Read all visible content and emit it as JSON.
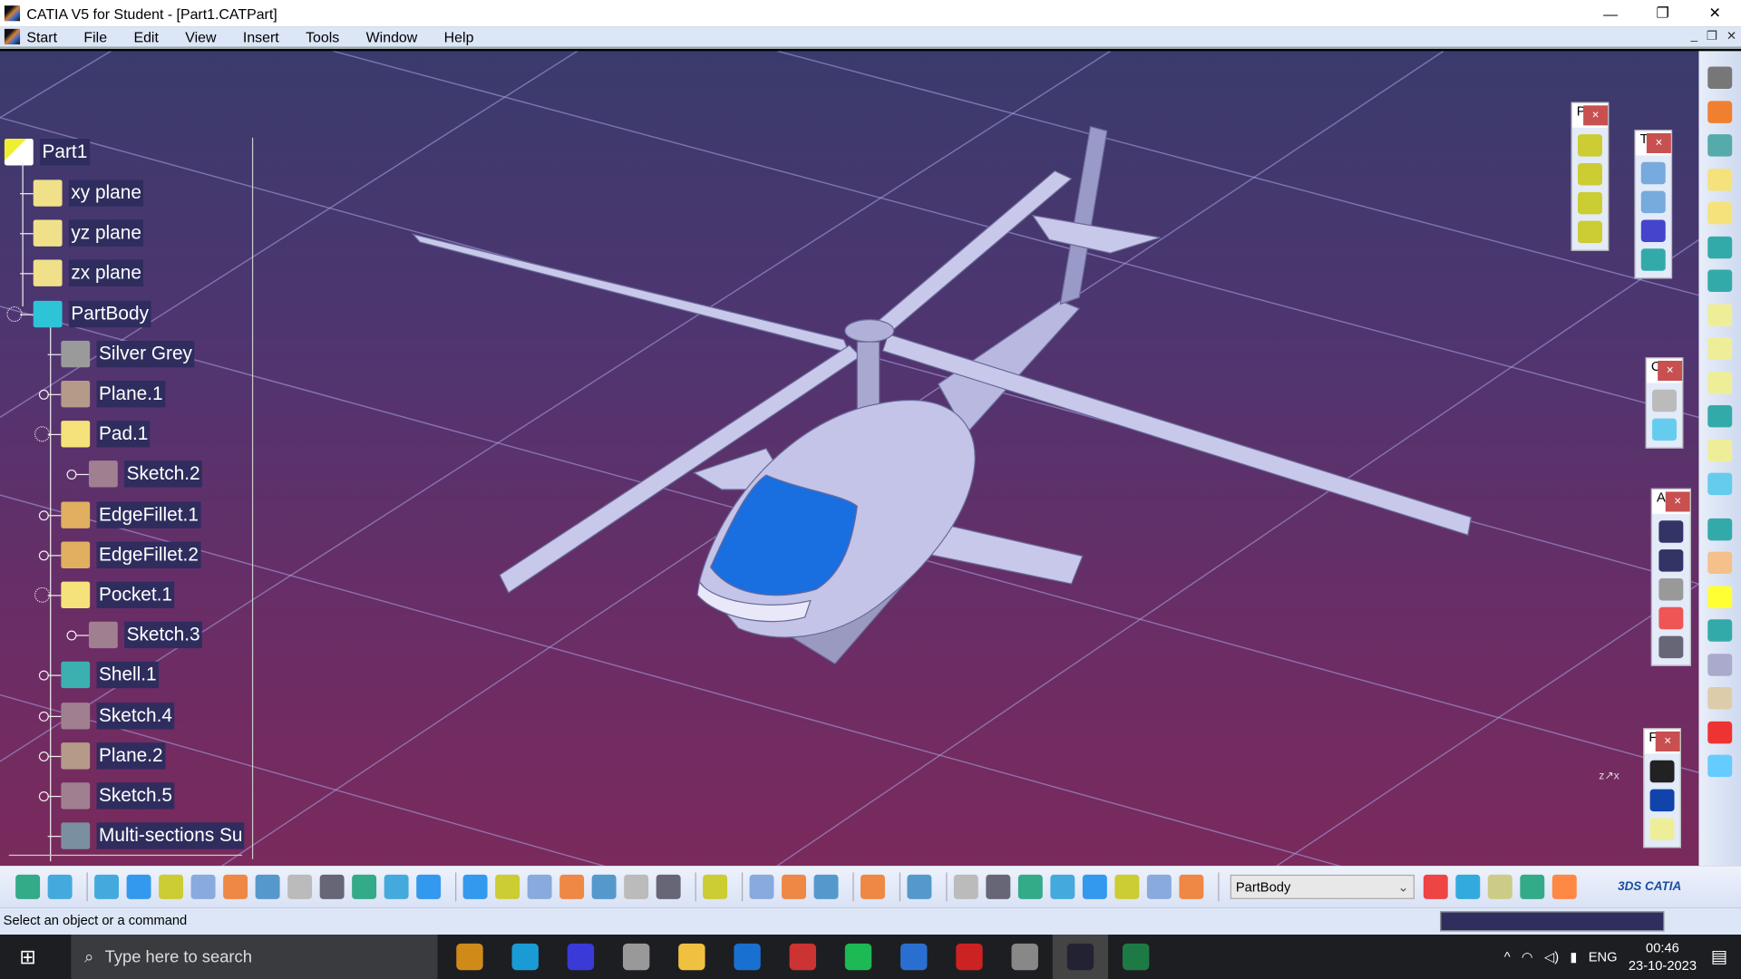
{
  "window": {
    "title": "CATIA V5 for Student - [Part1.CATPart]",
    "minimize": "—",
    "restore": "❐",
    "close": "✕"
  },
  "menu": [
    "Start",
    "File",
    "Edit",
    "View",
    "Insert",
    "Tools",
    "Window",
    "Help"
  ],
  "mdi_controls": [
    "_",
    "❐",
    "✕"
  ],
  "tree": {
    "root": "Part1",
    "items": [
      {
        "label": "xy plane",
        "icon": "plane-icon",
        "color": "#f0e08a"
      },
      {
        "label": "yz plane",
        "icon": "plane-icon",
        "color": "#f0e08a"
      },
      {
        "label": "zx plane",
        "icon": "plane-icon",
        "color": "#f0e08a"
      },
      {
        "label": "PartBody",
        "icon": "body-gear-icon",
        "color": "#2ec4d8"
      },
      {
        "label": "Silver Grey",
        "icon": "material-sphere-icon",
        "color": "#9a9a9a"
      },
      {
        "label": "Plane.1",
        "icon": "plane-feature-icon",
        "color": "#b59a8a"
      },
      {
        "label": "Pad.1",
        "icon": "pad-icon",
        "color": "#f5e27a"
      },
      {
        "label": "Sketch.2",
        "icon": "sketch-icon",
        "color": "#a08090"
      },
      {
        "label": "EdgeFillet.1",
        "icon": "edge-fillet-icon",
        "color": "#e0b060"
      },
      {
        "label": "EdgeFillet.2",
        "icon": "edge-fillet-icon",
        "color": "#e0b060"
      },
      {
        "label": "Pocket.1",
        "icon": "pocket-icon",
        "color": "#f5e27a"
      },
      {
        "label": "Sketch.3",
        "icon": "sketch-icon",
        "color": "#a08090"
      },
      {
        "label": "Shell.1",
        "icon": "shell-icon",
        "color": "#3ab0b0"
      },
      {
        "label": "Sketch.4",
        "icon": "sketch-icon",
        "color": "#a08090"
      },
      {
        "label": "Plane.2",
        "icon": "plane-feature-icon",
        "color": "#b59a8a"
      },
      {
        "label": "Sketch.5",
        "icon": "sketch-icon",
        "color": "#a08090"
      },
      {
        "label": "Multi-sections Su",
        "icon": "multi-sections-surface-icon",
        "color": "#7a90a0"
      }
    ]
  },
  "palettes": [
    {
      "title": "P",
      "icons": [
        "power-copy-icon",
        "power-copy-red-icon",
        "power-copy-blue-icon",
        "power-copy-instantiate-icon"
      ]
    },
    {
      "title": "T",
      "icons": [
        "translate-icon",
        "mirror-icon",
        "pattern-icon",
        "scaling-icon"
      ]
    },
    {
      "title": "C",
      "icons": [
        "constraint-dialog-icon",
        "constraint-icon"
      ]
    },
    {
      "title": "A",
      "icons": [
        "text-leader-icon",
        "flag-note-icon",
        "annotation-plane-icon",
        "3d-annotation-icon",
        "annotation-query-icon"
      ]
    },
    {
      "title": "F",
      "icons": [
        "point-icon",
        "line-icon",
        "plane-icon"
      ]
    }
  ],
  "right_toolbar": [
    "settings-icon",
    "select-icon",
    "sketch-icon",
    "pad-icon",
    "pocket-icon",
    "shaft-icon",
    "groove-icon",
    "hole-icon",
    "rib-icon",
    "slot-icon",
    "stiffener-icon",
    "multi-section-solid-icon",
    "removed-multi-section-icon",
    "edge-fillet-icon",
    "chamfer-icon",
    "draft-icon",
    "shell-icon",
    "thickness-icon",
    "thread-icon",
    "remove-face-icon",
    "surface-split-icon"
  ],
  "toolbar": {
    "groups": [
      [
        "undo-icon",
        "redo-icon"
      ],
      [
        "fly-mode-icon",
        "fit-all-icon",
        "pan-icon",
        "rotate-icon",
        "zoom-in-icon",
        "zoom-out-icon",
        "normal-view-icon",
        "iso-view-icon",
        "shading-icon",
        "hide-show-icon",
        "swap-space-icon"
      ],
      [
        "formula-icon",
        "comment-icon",
        "light-icon",
        "design-table-icon",
        "catalog-icon",
        "apply-material-icon",
        "measure-icon"
      ],
      [
        "scan-icon"
      ],
      [
        "measure-between-icon",
        "measure-item-icon",
        "measure-inertia-icon"
      ],
      [
        "capture-icon"
      ],
      [
        "grid-icon"
      ],
      [
        "update-icon",
        "manipulator-icon",
        "axis-system-icon",
        "snap-icon",
        "boolean-icon",
        "tool-icon",
        "parts-list-icon",
        "body-icon"
      ]
    ],
    "current_body": "PartBody",
    "after": [
      "instant-analysis-icon",
      "sketch-analysis-icon",
      "color-analysis-icon",
      "draft-analysis-icon",
      "knowledge-icon"
    ]
  },
  "status": "Select an object or a command",
  "taskbar": {
    "search_placeholder": "Type here to search",
    "apps": [
      "briefcase-app-icon",
      "edge-icon",
      "affinity-icon",
      "unity-icon",
      "file-explorer-icon",
      "skype-icon",
      "3dexperience-icon",
      "spotify-icon",
      "notepad-icon",
      "solidworks-icon",
      "workbench-icon",
      "catia-icon",
      "excel-icon"
    ],
    "app_colors": [
      "#d08a1a",
      "#1a9bd6",
      "#3a3ad8",
      "#999",
      "#f0c040",
      "#1a70d0",
      "#c33",
      "#1db954",
      "#2a6fd0",
      "#c22",
      "#888",
      "#223",
      "#1e7a44"
    ],
    "language": "ENG",
    "time": "00:46",
    "date": "23-10-2023"
  },
  "colors": {
    "viewport_top": "#3a3b6d",
    "viewport_bottom": "#7a2a5c",
    "canopy": "#1a6fe0",
    "body": "#c8c8ea"
  }
}
